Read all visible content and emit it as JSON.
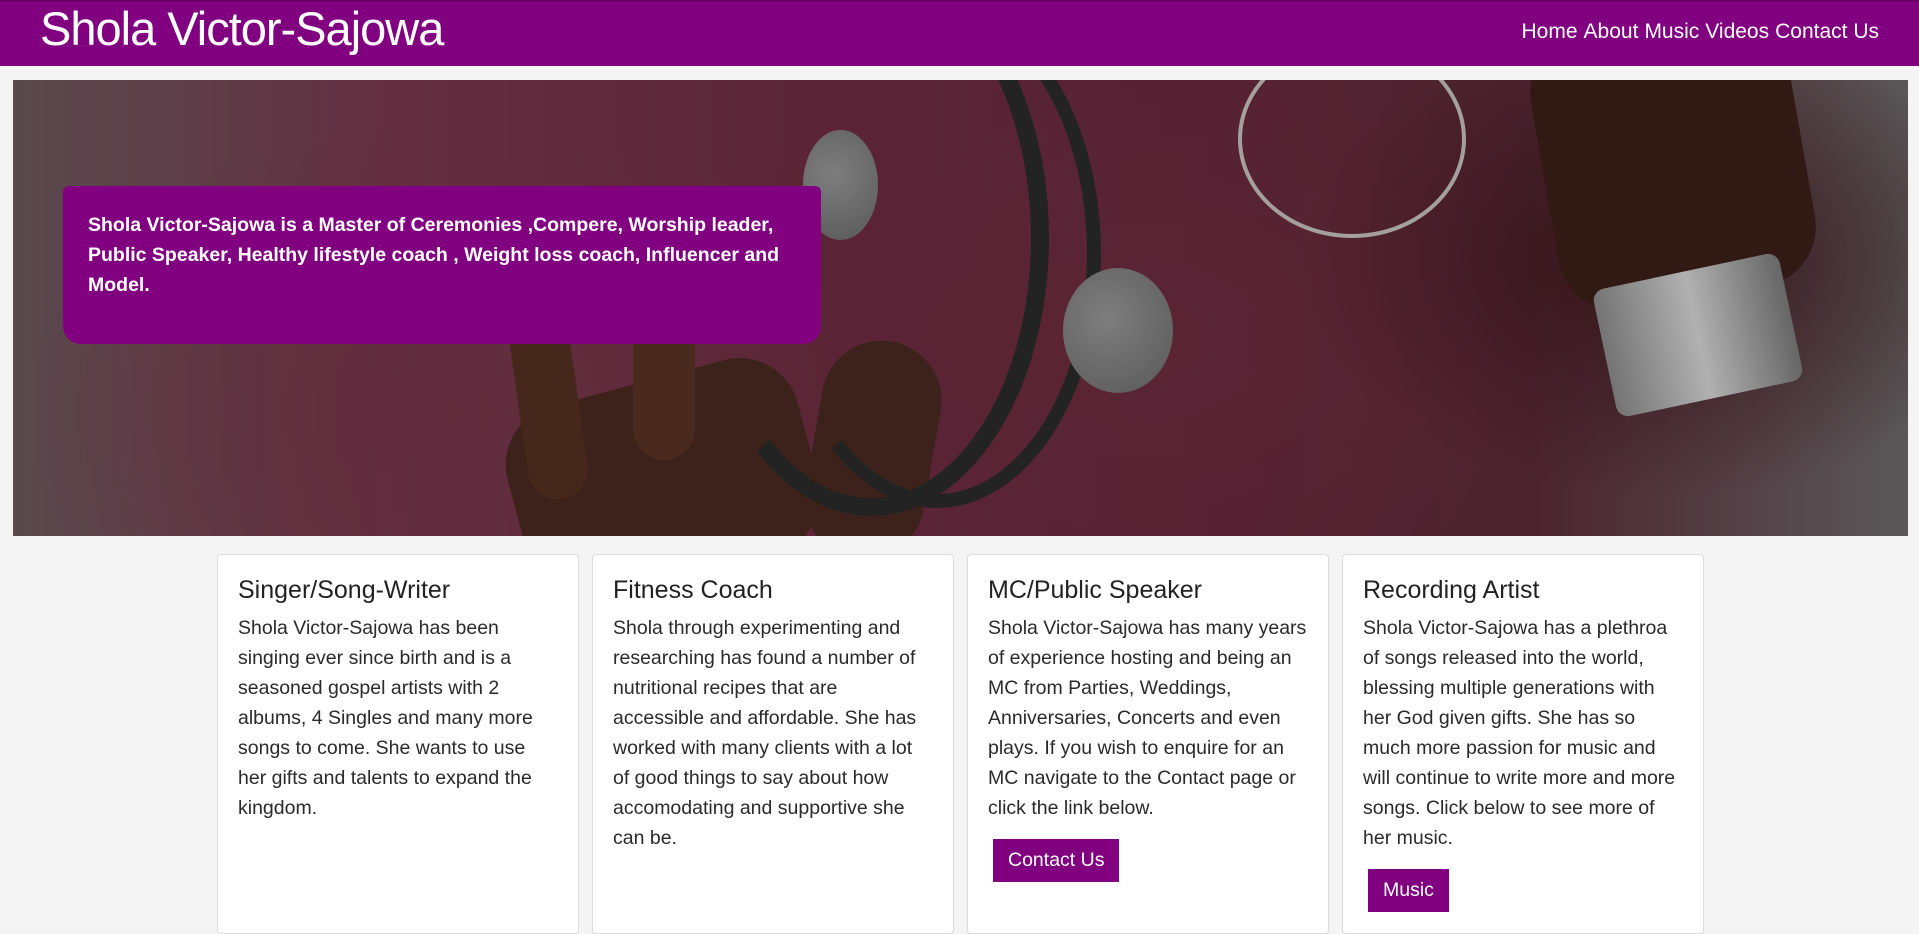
{
  "site": {
    "brand": "Shola Victor-Sajowa"
  },
  "nav": {
    "links": [
      {
        "label": "Home"
      },
      {
        "label": "About"
      },
      {
        "label": "Music"
      },
      {
        "label": "Videos"
      },
      {
        "label": "Contact Us"
      }
    ]
  },
  "hero": {
    "tagline": "Shola Victor-Sajowa is a Master of Ceremonies ,Compere, Worship leader, Public Speaker, Healthy lifestyle coach , Weight loss coach, Influencer and Model."
  },
  "cards": [
    {
      "title": "Singer/Song-Writer",
      "text": "Shola Victor-Sajowa has been singing ever since birth and is a seasoned gospel artists with 2 albums, 4 Singles and many more songs to come. She wants to use her gifts and talents to expand the kingdom."
    },
    {
      "title": "Fitness Coach",
      "text": "Shola through experimenting and researching has found a number of nutritional recipes that are accessible and affordable. She has worked with many clients with a lot of good things to say about how accomodating and supportive she can be."
    },
    {
      "title": "MC/Public Speaker",
      "text": "Shola Victor-Sajowa has many years of experience hosting and being an MC from Parties, Weddings, Anniversaries, Concerts and even plays. If you wish to enquire for an MC navigate to the Contact page or click the link below.",
      "button": "Contact Us"
    },
    {
      "title": "Recording Artist",
      "text": "Shola Victor-Sajowa has a plethroa of songs released into the world, blessing multiple generations with her God given gifts. She has so much more passion for music and will continue to write more and more songs. Click below to see more of her music.",
      "button": "Music"
    }
  ],
  "colors": {
    "brand_purple": "#800080",
    "page_background": "#f4f4f4"
  }
}
